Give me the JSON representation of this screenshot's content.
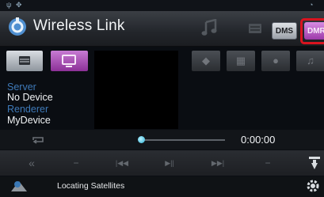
{
  "header": {
    "title": "Wireless Link"
  },
  "tabs": {
    "dms_label": "DMS",
    "dmr_label": "DMR"
  },
  "info": {
    "server_label": "Server",
    "server_value": "No Device",
    "renderer_label": "Renderer",
    "renderer_value": "MyDevice"
  },
  "playback": {
    "time": "0:00:00",
    "progress_fraction": 0.0
  },
  "status": {
    "message": "Locating Satellites"
  },
  "colors": {
    "accent": "#b04dbf",
    "highlight": "#d8141f",
    "label_blue": "#3e79b8"
  }
}
